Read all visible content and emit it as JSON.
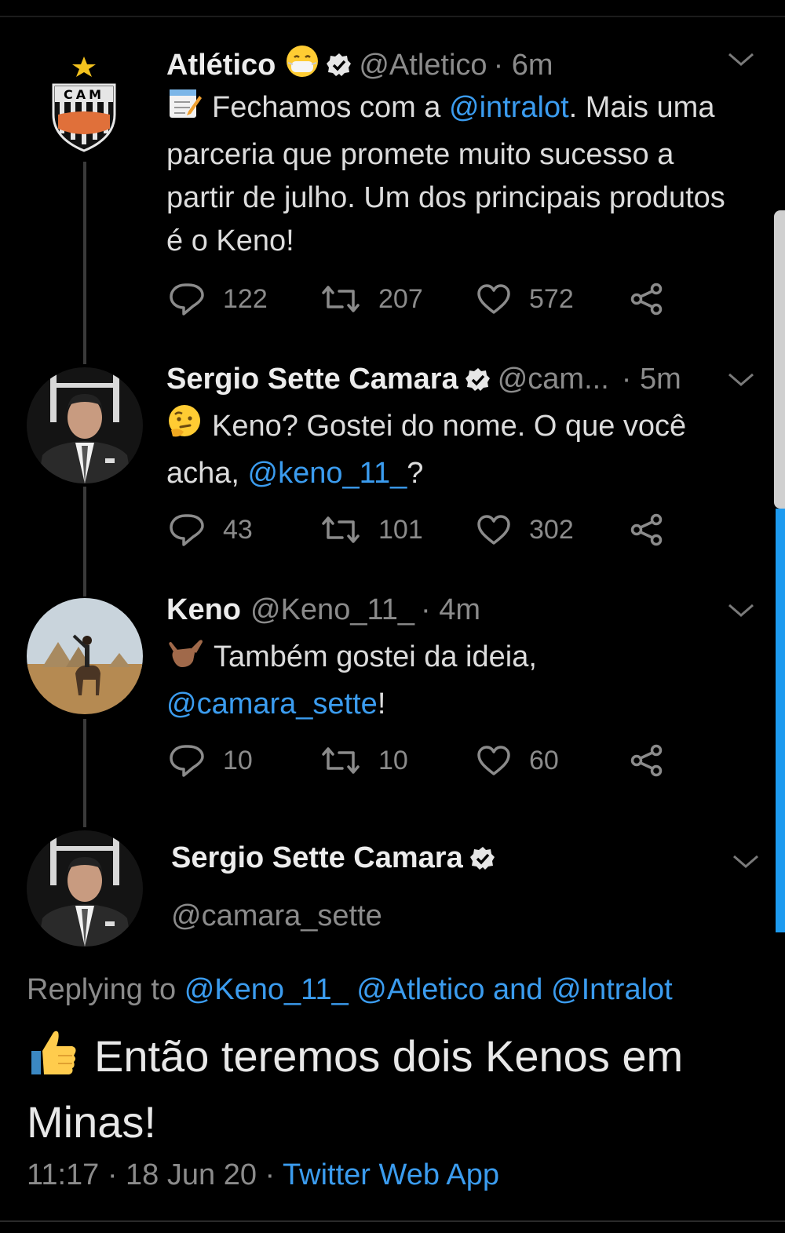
{
  "tweets": [
    {
      "name": "Atlético",
      "handle": "@Atletico",
      "time": "· 6m",
      "text_pre": "Fechamos com a ",
      "mention": "@intralot",
      "text_post": ". Mais uma parceria que promete muito sucesso a partir de julho. Um dos principais produtos é o Keno!",
      "avatar_text": "CAM",
      "replies": "122",
      "retweets": "207",
      "likes": "572",
      "icons": [
        "memo-emoji",
        "mask-face-emoji",
        "verified-badge"
      ]
    },
    {
      "name": "Sergio Sette Camara",
      "handle": "@cam...",
      "time": "· 5m",
      "text_pre": "Keno? Gostei do nome. O que você acha, ",
      "mention": "@keno_11_",
      "text_post": "?",
      "replies": "43",
      "retweets": "101",
      "likes": "302",
      "icons": [
        "thinking-face-emoji",
        "verified-badge"
      ]
    },
    {
      "name": "Keno",
      "handle": "@Keno_11_",
      "time": "· 4m",
      "text_pre": "Também gostei da ideia, ",
      "mention": "@camara_sette",
      "text_post": "!",
      "replies": "10",
      "retweets": "10",
      "likes": "60",
      "icons": [
        "call-me-hand-emoji"
      ]
    }
  ],
  "main_tweet": {
    "name": "Sergio Sette Camara",
    "handle": "@camara_sette",
    "replying_label": "Replying to",
    "replying_mentions": "@Keno_11_ @Atletico and @Intralot",
    "text": "Então teremos dois Kenos em Minas!",
    "time": "11:17 · 18 Jun 20 ·",
    "source": "Twitter Web App",
    "icons": [
      "thumbs-up-emoji",
      "verified-badge"
    ]
  },
  "colors": {
    "background": "#000000",
    "link": "#3b9cef",
    "muted": "#8b8b8b",
    "text": "#dcdcdc"
  }
}
